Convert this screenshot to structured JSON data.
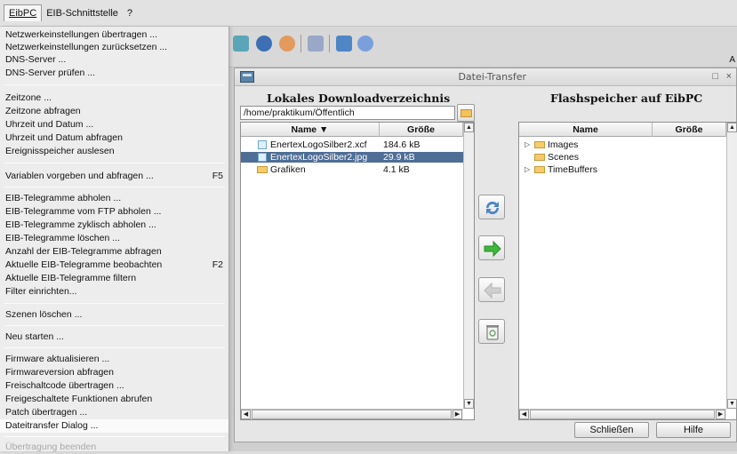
{
  "menubar": {
    "items": [
      {
        "label": "EibPC"
      },
      {
        "label": "EIB-Schnittstelle"
      },
      {
        "label": "?"
      }
    ]
  },
  "background": {
    "right_label": "A"
  },
  "menu": {
    "items": [
      {
        "label": "Netzwerkeinstellungen übertragen ...",
        "shortcut": ""
      },
      {
        "label": "Netzwerkeinstellungen zurücksetzen ...",
        "shortcut": ""
      },
      {
        "label": "DNS-Server ...",
        "shortcut": ""
      },
      {
        "label": "DNS-Server prüfen ...",
        "shortcut": ""
      },
      {
        "label": "Zeitzone ...",
        "shortcut": ""
      },
      {
        "label": "Zeitzone abfragen",
        "shortcut": ""
      },
      {
        "label": "Uhrzeit und Datum ...",
        "shortcut": ""
      },
      {
        "label": "Uhrzeit und Datum abfragen",
        "shortcut": ""
      },
      {
        "label": "Ereignisspeicher auslesen",
        "shortcut": ""
      },
      {
        "label": "Variablen vorgeben und abfragen ...",
        "shortcut": "F5"
      },
      {
        "label": "EIB-Telegramme abholen ...",
        "shortcut": ""
      },
      {
        "label": "EIB-Telegramme vom FTP abholen ...",
        "shortcut": ""
      },
      {
        "label": "EIB-Telegramme zyklisch abholen ...",
        "shortcut": ""
      },
      {
        "label": "EIB-Telegramme löschen ...",
        "shortcut": ""
      },
      {
        "label": "Anzahl der EIB-Telegramme abfragen",
        "shortcut": ""
      },
      {
        "label": "Aktuelle EIB-Telegramme beobachten",
        "shortcut": "F2"
      },
      {
        "label": "Aktuelle EIB-Telegramme filtern",
        "shortcut": ""
      },
      {
        "label": "Filter einrichten...",
        "shortcut": ""
      },
      {
        "label": "Szenen löschen ...",
        "shortcut": ""
      },
      {
        "label": "Neu starten ...",
        "shortcut": ""
      },
      {
        "label": "Firmware aktualisieren ...",
        "shortcut": ""
      },
      {
        "label": "Firmwareversion abfragen",
        "shortcut": ""
      },
      {
        "label": "Freischaltcode übertragen ...",
        "shortcut": ""
      },
      {
        "label": "Freigeschaltete Funktionen abrufen",
        "shortcut": ""
      },
      {
        "label": "Patch übertragen ...",
        "shortcut": ""
      },
      {
        "label": "Dateitransfer Dialog ...",
        "shortcut": ""
      },
      {
        "label": "Übertragung beenden",
        "shortcut": ""
      }
    ]
  },
  "dialog": {
    "title": "Datei-Transfer",
    "local": {
      "title": "Lokales Downloadverzeichnis",
      "path": "/home/praktikum/Öffentlich",
      "col_name": "Name ▼",
      "col_size": "Größe",
      "rows": [
        {
          "name": "EnertexLogoSilber2.xcf",
          "size": "184.6 kB",
          "type": "file",
          "selected": false
        },
        {
          "name": "EnertexLogoSilber2.jpg",
          "size": "29.9 kB",
          "type": "file",
          "selected": true
        },
        {
          "name": "Grafiken",
          "size": "4.1 kB",
          "type": "folder",
          "selected": false
        }
      ]
    },
    "remote": {
      "title": "Flashspeicher auf EibPC",
      "col_name": "Name",
      "col_size": "Größe",
      "rows": [
        {
          "name": "Images",
          "expandable": true
        },
        {
          "name": "Scenes",
          "expandable": false
        },
        {
          "name": "TimeBuffers",
          "expandable": true
        }
      ]
    },
    "close_label": "Schließen",
    "help_label": "Hilfe"
  },
  "colors": {
    "selection": "#4f6e96",
    "menu_bg": "#ededed"
  }
}
